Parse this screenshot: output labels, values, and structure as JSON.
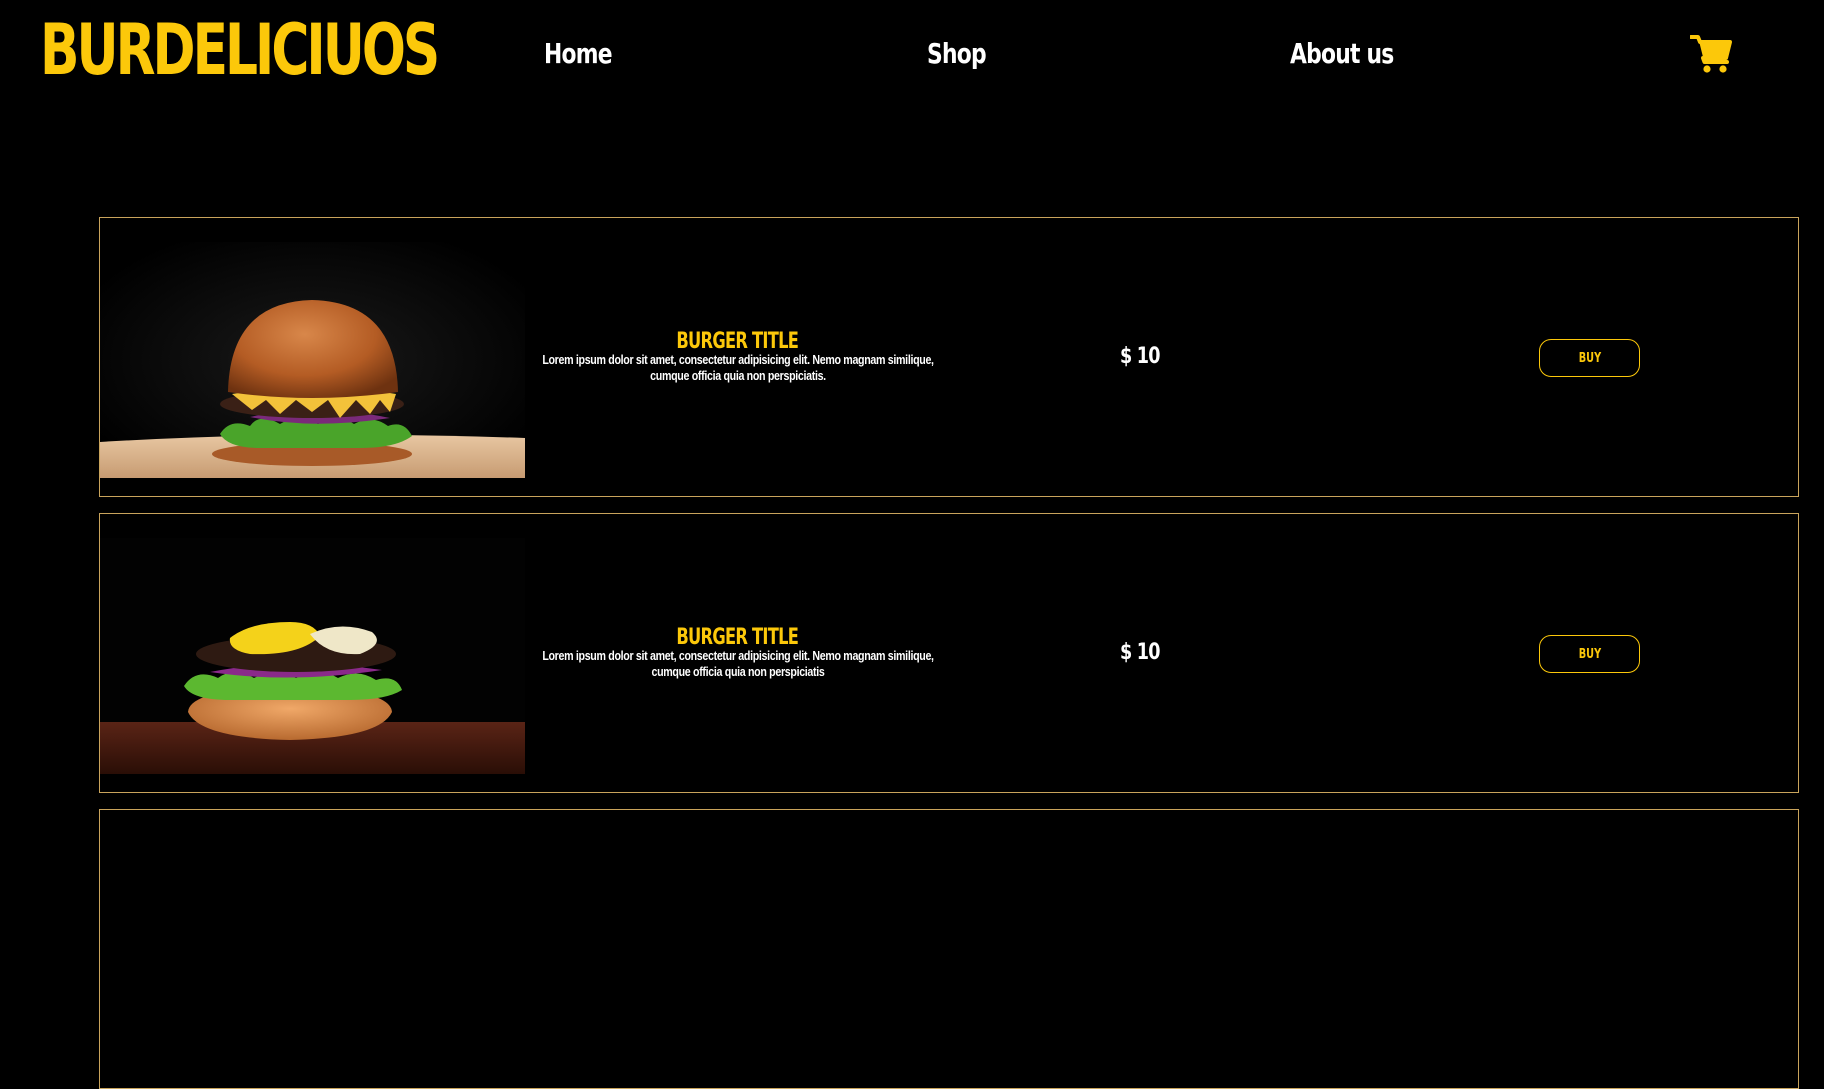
{
  "header": {
    "brand": "BURDELICIUOS",
    "nav": {
      "home": "Home",
      "shop": "Shop",
      "about": "About us"
    },
    "cart_icon": "shopping-cart-icon"
  },
  "products": [
    {
      "title": "BURGER TITLE",
      "description": "Lorem ipsum dolor sit amet, consectetur adipisicing elit. Nemo magnam similique, cumque officia quia non perspiciatis.",
      "price": "$ 10",
      "buy_label": "BUY"
    },
    {
      "title": "BURGER TITLE",
      "description": "Lorem ipsum dolor sit amet, consectetur adipisicing elit. Nemo magnam similique, cumque officia quia non perspiciatis",
      "price": "$ 10",
      "buy_label": "BUY"
    }
  ],
  "colors": {
    "accent": "#fcc80a",
    "card_border": "#c9a45c",
    "background": "#000000",
    "text": "#ffffff"
  }
}
